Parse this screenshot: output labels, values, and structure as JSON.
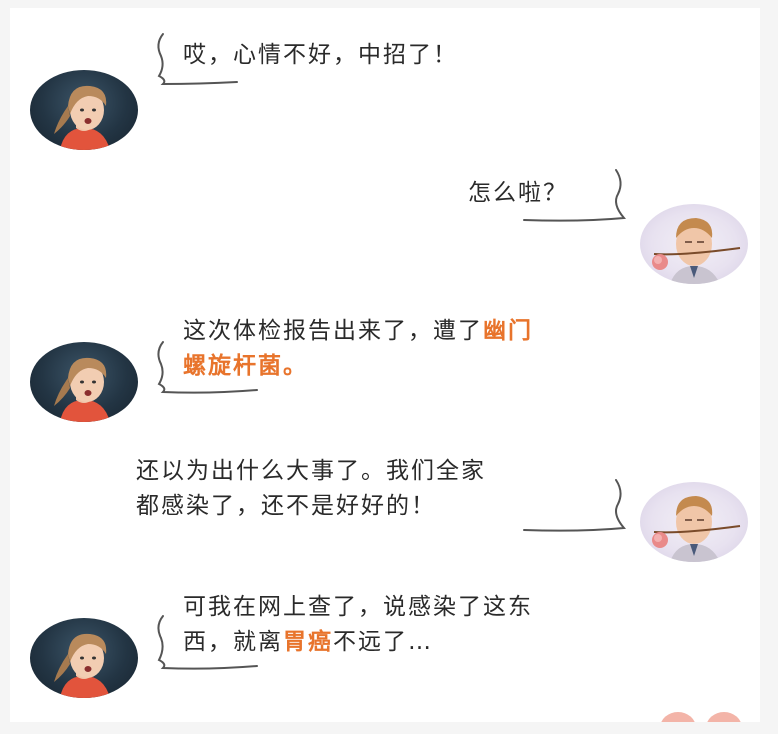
{
  "conversation": [
    {
      "side": "left",
      "speaker": "girl",
      "lines": [
        [
          {
            "t": "哎，心情不好，中招了！"
          }
        ]
      ]
    },
    {
      "side": "right",
      "speaker": "boy",
      "lines": [
        [
          {
            "t": "怎么啦？"
          }
        ]
      ]
    },
    {
      "side": "left",
      "speaker": "girl",
      "lines": [
        [
          {
            "t": "这次体检报告出来了，遭了"
          },
          {
            "t": "幽门",
            "hl": true
          }
        ],
        [
          {
            "t": "螺旋杆菌。",
            "hl": true
          }
        ]
      ]
    },
    {
      "side": "right",
      "speaker": "boy",
      "lines": [
        [
          {
            "t": "还以为出什么大事了。我们全家"
          }
        ],
        [
          {
            "t": "都感染了，还不是好好的！"
          }
        ]
      ]
    },
    {
      "side": "left",
      "speaker": "girl",
      "lines": [
        [
          {
            "t": "可我在网上查了，说感染了这东"
          }
        ],
        [
          {
            "t": "西，就离"
          },
          {
            "t": "胃癌",
            "hl": true
          },
          {
            "t": "不远了…"
          }
        ]
      ]
    }
  ],
  "colors": {
    "highlight": "#e8742c",
    "text": "#2a2a2a",
    "background": "#ffffff"
  },
  "icons": {
    "girl": "girl-avatar",
    "boy": "boy-avatar"
  }
}
